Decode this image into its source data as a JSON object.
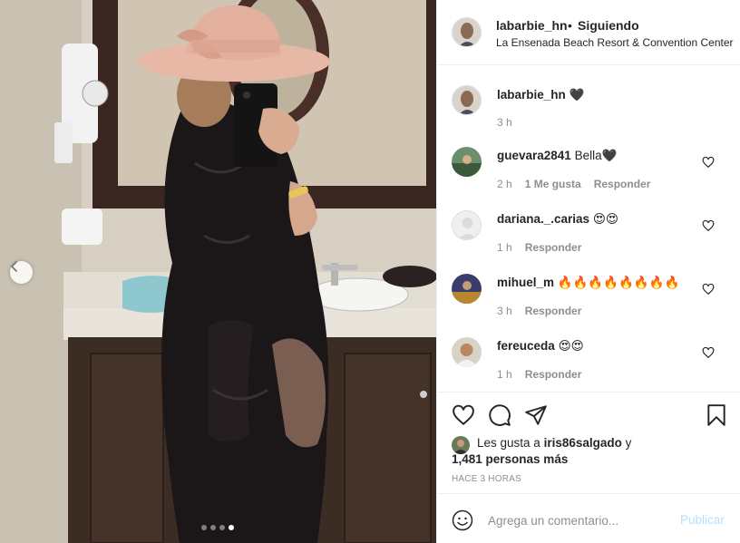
{
  "post": {
    "username": "labarbie_hn",
    "separator": "•",
    "follow_status": "Siguiendo",
    "location": "La Ensenada Beach Resort & Convention Center"
  },
  "caption": {
    "username": "labarbie_hn",
    "text": "🖤",
    "time": "3 h"
  },
  "comments": [
    {
      "username": "guevara2841",
      "text": "Bella🖤",
      "time": "2 h",
      "likes": "1 Me gusta",
      "reply": "Responder"
    },
    {
      "username": "dariana._.carias",
      "text": "😍😍",
      "time": "1 h",
      "likes": "",
      "reply": "Responder"
    },
    {
      "username": "mihuel_m",
      "text": "🔥🔥🔥🔥🔥🔥🔥🔥",
      "time": "3 h",
      "likes": "",
      "reply": "Responder"
    },
    {
      "username": "fereuceda",
      "text": "😍😍",
      "time": "1 h",
      "likes": "",
      "reply": "Responder"
    }
  ],
  "likes": {
    "prefix": "Les gusta a",
    "user": "iris86salgado",
    "conj": "y",
    "others": "1,481 personas más"
  },
  "time_ago": "HACE 3 HORAS",
  "add_comment": {
    "placeholder": "Agrega un comentario...",
    "publish_label": "Publicar"
  },
  "carousel": {
    "count": 4,
    "active_index": 3
  },
  "icons": {
    "heart": "heart-icon",
    "comment": "comment-icon",
    "share": "share-icon",
    "bookmark": "bookmark-icon",
    "emoji": "emoji-icon",
    "prev": "chevron-left-icon"
  },
  "colors": {
    "text": "#262626",
    "muted": "#8e8e8e",
    "border": "#efefef",
    "publish": "#b2dffc"
  }
}
